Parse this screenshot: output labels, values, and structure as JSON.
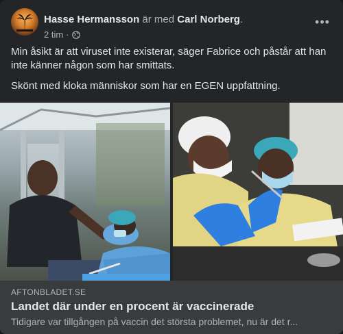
{
  "post": {
    "author": "Hasse Hermansson",
    "with_text": "är med",
    "tagged": "Carl Norberg",
    "tagged_suffix": ".",
    "time": "2 tim",
    "audience_icon": "globe-icon",
    "more_icon": "more-icon",
    "more_label": "•••",
    "paragraphs": [
      "Min åsikt är att viruset inte existerar, säger Fabrice och påstår att han inte känner någon som har smittats.",
      "Skönt med kloka människor som har en EGEN uppfattning."
    ]
  },
  "link": {
    "domain": "AFTONBLADET.SE",
    "title": "Landet där under en procent är vaccinerade",
    "description": "Tidigare var tillgången på vaccin det största problemet, nu är det r..."
  },
  "colors": {
    "card": "#242526",
    "link_box": "#3a3b3c",
    "text": "#e4e6eb",
    "muted": "#b0b3b8",
    "scrub_blue": "#5ea0d8",
    "cap_teal": "#3aa8b8",
    "glove_blue": "#2f7fe0",
    "gown_yellow": "#e6d98a"
  }
}
